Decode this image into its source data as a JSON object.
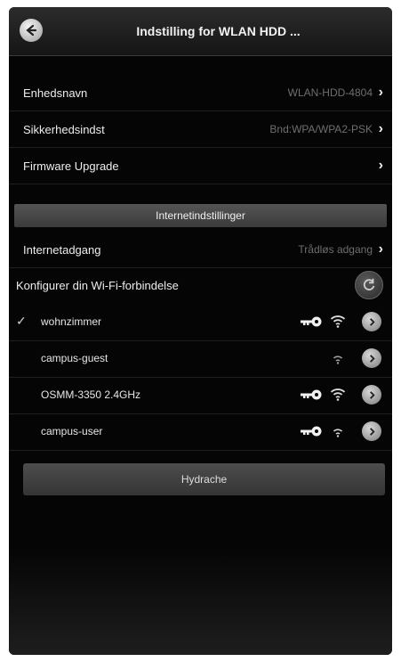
{
  "header": {
    "title": "Indstilling for WLAN HDD ..."
  },
  "device": {
    "rows": [
      {
        "label": "Enhedsnavn",
        "value": "WLAN-HDD-4804"
      },
      {
        "label": "Sikkerhedsindst",
        "value": "Bnd:WPA/WPA2-PSK"
      },
      {
        "label": "Firmware Upgrade",
        "value": ""
      }
    ]
  },
  "internet": {
    "section_title": "Internetindstillinger",
    "access_label": "Internetadgang",
    "access_value": "Trådløs adgang",
    "config_label": "Konfigurer din Wi-Fi-forbindelse"
  },
  "networks": [
    {
      "ssid": "wohnzimmer",
      "connected": true,
      "secured": true
    },
    {
      "ssid": "campus-guest",
      "connected": false,
      "secured": false
    },
    {
      "ssid": "OSMM-3350 2.4GHz",
      "connected": false,
      "secured": true
    },
    {
      "ssid": "campus-user",
      "connected": false,
      "secured": true
    }
  ],
  "actions": {
    "refresh_label": "Hydrache"
  },
  "icons": {
    "back": "back-arrow-icon",
    "chevron": "chevron-right-icon",
    "refresh": "refresh-icon",
    "key": "key-icon",
    "wifi": "wifi-signal-icon",
    "info": "info-arrow-icon",
    "check": "checkmark-icon"
  }
}
